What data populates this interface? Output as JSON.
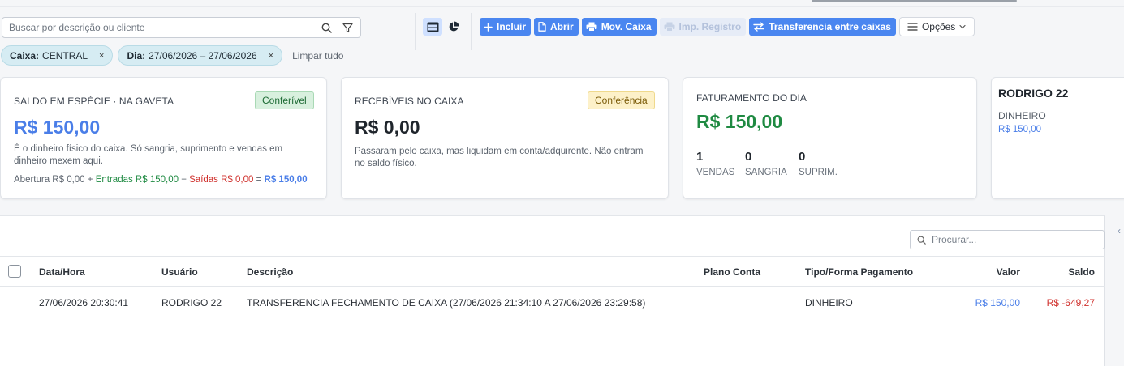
{
  "search": {
    "placeholder": "Buscar por descrição ou cliente"
  },
  "toolbar": {
    "incluir": "Incluir",
    "abrir": "Abrir",
    "mov_caixa": "Mov. Caixa",
    "imp_registro": "Imp. Registro",
    "transferencia": "Transferencia entre caixas",
    "opcoes": "Opções"
  },
  "filters": {
    "caixa_label": "Caixa:",
    "caixa_value": "CENTRAL",
    "dia_label": "Dia:",
    "dia_value": "27/06/2026 – 27/06/2026",
    "remove": "×",
    "clear": "Limpar tudo"
  },
  "cards": {
    "saldo": {
      "title": "SALDO EM ESPÉCIE · NA GAVETA",
      "badge": "Conferível",
      "value": "R$ 150,00",
      "desc_line1": "É o dinheiro físico do caixa. Só sangria, suprimento e vendas em",
      "desc_line2": "dinheiro mexem aqui.",
      "f_abertura": "Abertura R$ 0,00 +",
      "f_entradas": "Entradas R$ 150,00",
      "f_minus": "−",
      "f_saidas": "Saídas R$ 0,00",
      "f_eq": "=",
      "f_total": "R$ 150,00"
    },
    "recebiveis": {
      "title": "RECEBÍVEIS NO CAIXA",
      "badge": "Conferência",
      "value": "R$ 0,00",
      "desc_line1": "Passaram pelo caixa, mas liquidam em conta/adquirente. Não entram",
      "desc_line2": "no saldo físico."
    },
    "faturamento": {
      "title": "FATURAMENTO DO DIA",
      "value": "R$ 150,00",
      "stats": [
        {
          "n": "1",
          "label": "VENDAS"
        },
        {
          "n": "0",
          "label": "SANGRIA"
        },
        {
          "n": "0",
          "label": "SUPRIM."
        }
      ]
    },
    "user": {
      "name": "RODRIGO 22",
      "method": "DINHEIRO",
      "amount": "R$ 150,00"
    }
  },
  "table": {
    "search_placeholder": "Procurar...",
    "columns": [
      "Data/Hora",
      "Usuário",
      "Descrição",
      "Plano Conta",
      "Tipo/Forma Pagamento",
      "Valor",
      "Saldo"
    ],
    "rows": [
      {
        "data_hora": "27/06/2026 20:30:41",
        "usuario": "RODRIGO 22",
        "descricao": "TRANSFERENCIA FECHAMENTO DE CAIXA (27/06/2026 21:34:10 A 27/06/2026 23:29:58)",
        "plano_conta": "",
        "tipo": "DINHEIRO",
        "valor": "R$ 150,00",
        "saldo": "R$ -649,27"
      }
    ]
  },
  "colors": {
    "primary": "#4a86f0",
    "money_blue": "#4a7ee8",
    "money_green": "#1f8a42",
    "negative_red": "#d0312d"
  },
  "side_chevron": "‹"
}
